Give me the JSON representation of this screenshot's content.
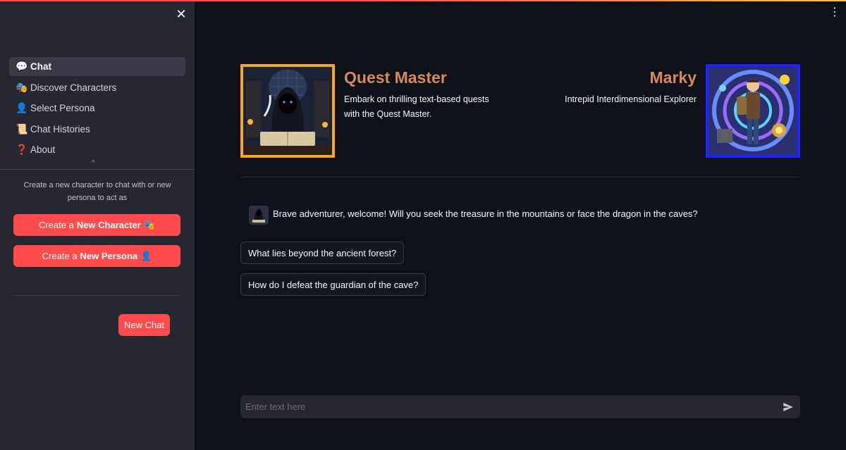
{
  "sidebar": {
    "close_glyph": "✕",
    "nav": [
      {
        "label": "Chat",
        "icon": "speech-bubble-icon",
        "glyph": "💬",
        "active": true
      },
      {
        "label": "Discover Characters",
        "icon": "theater-masks-icon",
        "glyph": "🎭",
        "active": false
      },
      {
        "label": "Select Persona",
        "icon": "person-silhouette-icon",
        "glyph": "👤",
        "active": false
      },
      {
        "label": "Chat Histories",
        "icon": "scroll-icon",
        "glyph": "📜",
        "active": false
      },
      {
        "label": "About",
        "icon": "question-mark-icon",
        "glyph": "❓",
        "active": false
      }
    ],
    "collapse_glyph": "^",
    "hint": "Create a new character to chat with or new persona to act as",
    "create_character": {
      "prefix": "Create a ",
      "bold": "New Character",
      "emoji": "🎭"
    },
    "create_persona": {
      "prefix": "Create a ",
      "bold": "New Persona",
      "emoji": "👤"
    },
    "new_chat": "New Chat"
  },
  "header": {
    "menu_glyph": "⋮"
  },
  "characters": {
    "left": {
      "name": "Quest Master",
      "description": "Embark on thrilling text-based quests with the Quest Master.",
      "border_color": "#f5a623"
    },
    "right": {
      "name": "Marky",
      "description": "Intrepid Interdimensional Explorer",
      "border_color": "#1a22ff"
    },
    "name_color": "#d8895a"
  },
  "chat": {
    "messages": [
      {
        "text": "Brave adventurer, welcome! Will you seek the treasure in the mountains or face the dragon in the caves?"
      }
    ],
    "suggestions": [
      "What lies beyond the ancient forest?",
      "How do I defeat the guardian of the cave?"
    ],
    "input": {
      "placeholder": "Enter text here",
      "value": ""
    }
  },
  "colors": {
    "accent": "#ff4b4b",
    "background": "#0e1117",
    "sidebar": "#262730"
  }
}
